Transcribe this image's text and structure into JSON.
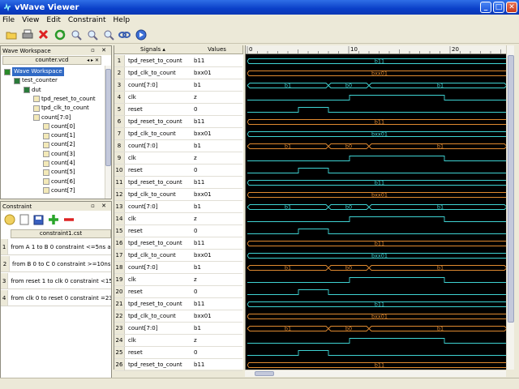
{
  "window": {
    "title": "vWave Viewer"
  },
  "menu": [
    "File",
    "View",
    "Edit",
    "Constraint",
    "Help"
  ],
  "toolbar_icons": [
    "open-folder-icon",
    "print-icon",
    "delete-icon",
    "refresh-icon",
    "zoom-in-icon",
    "zoom-out-icon",
    "zoom-fit-icon",
    "link-icon",
    "navigate-icon"
  ],
  "workspace": {
    "title": "Wave Workspace",
    "file": "counter.vcd",
    "tree": [
      {
        "label": "Wave Workspace",
        "level": 0,
        "icon": "workspace-icon",
        "selected": true
      },
      {
        "label": "test_counter",
        "level": 1,
        "icon": "module-icon"
      },
      {
        "label": "dut",
        "level": 2,
        "icon": "module-icon"
      },
      {
        "label": "tpd_reset_to_count",
        "level": 3,
        "icon": "signal-icon"
      },
      {
        "label": "tpd_clk_to_count",
        "level": 3,
        "icon": "signal-icon"
      },
      {
        "label": "count[7:0]",
        "level": 3,
        "icon": "bus-icon"
      },
      {
        "label": "count[0]",
        "level": 4,
        "icon": "signal-icon"
      },
      {
        "label": "count[1]",
        "level": 4,
        "icon": "signal-icon"
      },
      {
        "label": "count[2]",
        "level": 4,
        "icon": "signal-icon"
      },
      {
        "label": "count[3]",
        "level": 4,
        "icon": "signal-icon"
      },
      {
        "label": "count[4]",
        "level": 4,
        "icon": "signal-icon"
      },
      {
        "label": "count[5]",
        "level": 4,
        "icon": "signal-icon"
      },
      {
        "label": "count[6]",
        "level": 4,
        "icon": "signal-icon"
      },
      {
        "label": "count[7]",
        "level": 4,
        "icon": "signal-icon"
      }
    ]
  },
  "constraint": {
    "title": "Constraint",
    "file": "constraint1.cst",
    "rows": [
      {
        "num": "1",
        "text": "from A 1 to B 0 constraint <=5ns after 1..."
      },
      {
        "num": "2",
        "text": "from B 0 to C 0 constraint >=10ns"
      },
      {
        "num": "3",
        "text": "from reset 1 to clk 0 constraint <15ns af..."
      },
      {
        "num": "4",
        "text": "from clk 0 to reset 0 constraint =23ns af..."
      }
    ]
  },
  "signals_header": "Signals",
  "values_header": "Values",
  "ruler": {
    "marks": [
      "0",
      "10",
      "20"
    ]
  },
  "rows": [
    {
      "num": "1",
      "name": "tpd_reset_to_count",
      "value": "b11",
      "kind": "const",
      "label": "b11",
      "color": "#3fd3d3"
    },
    {
      "num": "2",
      "name": "tpd_clk_to_count",
      "value": "bxx01",
      "kind": "const",
      "label": "bxx01",
      "color": "#e08a30"
    },
    {
      "num": "3",
      "name": "count[7:0]",
      "value": "b1",
      "kind": "bus",
      "segs": [
        "b1",
        "b0",
        "b1"
      ],
      "color": "#3fd3d3"
    },
    {
      "num": "4",
      "name": "clk",
      "value": "z",
      "kind": "clk"
    },
    {
      "num": "5",
      "name": "reset",
      "value": "0",
      "kind": "reset"
    },
    {
      "num": "6",
      "name": "tpd_reset_to_count",
      "value": "b11",
      "kind": "const",
      "label": "b11",
      "color": "#e08a30"
    },
    {
      "num": "7",
      "name": "tpd_clk_to_count",
      "value": "bxx01",
      "kind": "const",
      "label": "bxx01",
      "color": "#3fd3d3"
    },
    {
      "num": "8",
      "name": "count[7:0]",
      "value": "b1",
      "kind": "bus",
      "segs": [
        "b1",
        "b0",
        "b1"
      ],
      "color": "#e08a30"
    },
    {
      "num": "9",
      "name": "clk",
      "value": "z",
      "kind": "clk"
    },
    {
      "num": "10",
      "name": "reset",
      "value": "0",
      "kind": "reset"
    },
    {
      "num": "11",
      "name": "tpd_reset_to_count",
      "value": "b11",
      "kind": "const",
      "label": "b11",
      "color": "#3fd3d3"
    },
    {
      "num": "12",
      "name": "tpd_clk_to_count",
      "value": "bxx01",
      "kind": "const",
      "label": "bxx01",
      "color": "#e08a30"
    },
    {
      "num": "13",
      "name": "count[7:0]",
      "value": "b1",
      "kind": "bus",
      "segs": [
        "b1",
        "b0",
        "b1"
      ],
      "color": "#3fd3d3"
    },
    {
      "num": "14",
      "name": "clk",
      "value": "z",
      "kind": "clk"
    },
    {
      "num": "15",
      "name": "reset",
      "value": "0",
      "kind": "reset"
    },
    {
      "num": "16",
      "name": "tpd_reset_to_count",
      "value": "b11",
      "kind": "const",
      "label": "b11",
      "color": "#e08a30"
    },
    {
      "num": "17",
      "name": "tpd_clk_to_count",
      "value": "bxx01",
      "kind": "const",
      "label": "bxx01",
      "color": "#3fd3d3"
    },
    {
      "num": "18",
      "name": "count[7:0]",
      "value": "b1",
      "kind": "bus",
      "segs": [
        "b1",
        "b0",
        "b1"
      ],
      "color": "#e08a30"
    },
    {
      "num": "19",
      "name": "clk",
      "value": "z",
      "kind": "clk"
    },
    {
      "num": "20",
      "name": "reset",
      "value": "0",
      "kind": "reset"
    },
    {
      "num": "21",
      "name": "tpd_reset_to_count",
      "value": "b11",
      "kind": "const",
      "label": "b11",
      "color": "#3fd3d3"
    },
    {
      "num": "22",
      "name": "tpd_clk_to_count",
      "value": "bxx01",
      "kind": "const",
      "label": "bxx01",
      "color": "#e08a30"
    },
    {
      "num": "23",
      "name": "count[7:0]",
      "value": "b1",
      "kind": "bus",
      "segs": [
        "b1",
        "b0",
        "b1"
      ],
      "color": "#e08a30"
    },
    {
      "num": "24",
      "name": "clk",
      "value": "z",
      "kind": "clk"
    },
    {
      "num": "25",
      "name": "reset",
      "value": "0",
      "kind": "reset"
    },
    {
      "num": "26",
      "name": "tpd_reset_to_count",
      "value": "b11",
      "kind": "const",
      "label": "b11",
      "color": "#e08a30"
    }
  ]
}
